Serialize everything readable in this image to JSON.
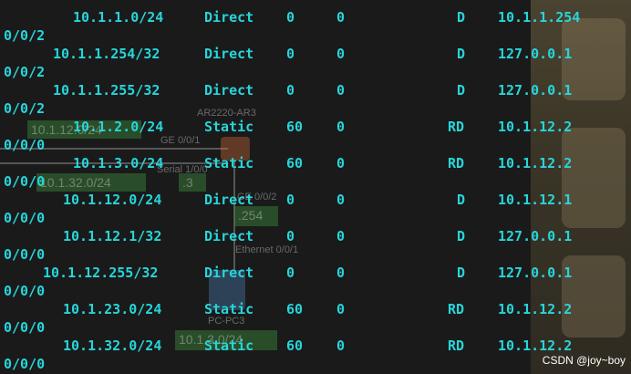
{
  "background": {
    "router_label": "AR2220-AR3",
    "port_ge_0_0_1": "GE 0/0/1",
    "port_serial": "Serial 1/0/0",
    "port_ge_0_0_2": "GE 0/0/2",
    "port_ethernet": "Ethernet 0/0/1",
    "pc_label": "PC-PC3",
    "net_badge_1": "10.1.12.0/24",
    "net_badge_2": "10.1.32.0/24",
    "net_badge_3": ".3",
    "net_badge_4": ".254",
    "net_badge_5": "10.1.3.0/24"
  },
  "routes": [
    {
      "dest": "10.1.1.0/24",
      "proto": "Direct",
      "pre": "0",
      "cost": "0",
      "flags": "D",
      "nexthop": "10.1.1.254",
      "iface": "0/0/2"
    },
    {
      "dest": "10.1.1.254/32",
      "proto": "Direct",
      "pre": "0",
      "cost": "0",
      "flags": "D",
      "nexthop": "127.0.0.1",
      "iface": "0/0/2"
    },
    {
      "dest": "10.1.1.255/32",
      "proto": "Direct",
      "pre": "0",
      "cost": "0",
      "flags": "D",
      "nexthop": "127.0.0.1",
      "iface": "0/0/2"
    },
    {
      "dest": "10.1.2.0/24",
      "proto": "Static",
      "pre": "60",
      "cost": "0",
      "flags": "RD",
      "nexthop": "10.1.12.2",
      "iface": "0/0/0"
    },
    {
      "dest": "10.1.3.0/24",
      "proto": "Static",
      "pre": "60",
      "cost": "0",
      "flags": "RD",
      "nexthop": "10.1.12.2",
      "iface": "0/0/0"
    },
    {
      "dest": "10.1.12.0/24",
      "proto": "Direct",
      "pre": "0",
      "cost": "0",
      "flags": "D",
      "nexthop": "10.1.12.1",
      "iface": "0/0/0"
    },
    {
      "dest": "10.1.12.1/32",
      "proto": "Direct",
      "pre": "0",
      "cost": "0",
      "flags": "D",
      "nexthop": "127.0.0.1",
      "iface": "0/0/0"
    },
    {
      "dest": "10.1.12.255/32",
      "proto": "Direct",
      "pre": "0",
      "cost": "0",
      "flags": "D",
      "nexthop": "127.0.0.1",
      "iface": "0/0/0"
    },
    {
      "dest": "10.1.23.0/24",
      "proto": "Static",
      "pre": "60",
      "cost": "0",
      "flags": "RD",
      "nexthop": "10.1.12.2",
      "iface": "0/0/0"
    },
    {
      "dest": "10.1.32.0/24",
      "proto": "Static",
      "pre": "60",
      "cost": "0",
      "flags": "RD",
      "nexthop": "10.1.12.2",
      "iface": "0/0/0"
    }
  ],
  "watermark": "CSDN @joy~boy",
  "colors": {
    "terminal_text": "#27d5da",
    "terminal_bg": "#1a1a1a"
  }
}
